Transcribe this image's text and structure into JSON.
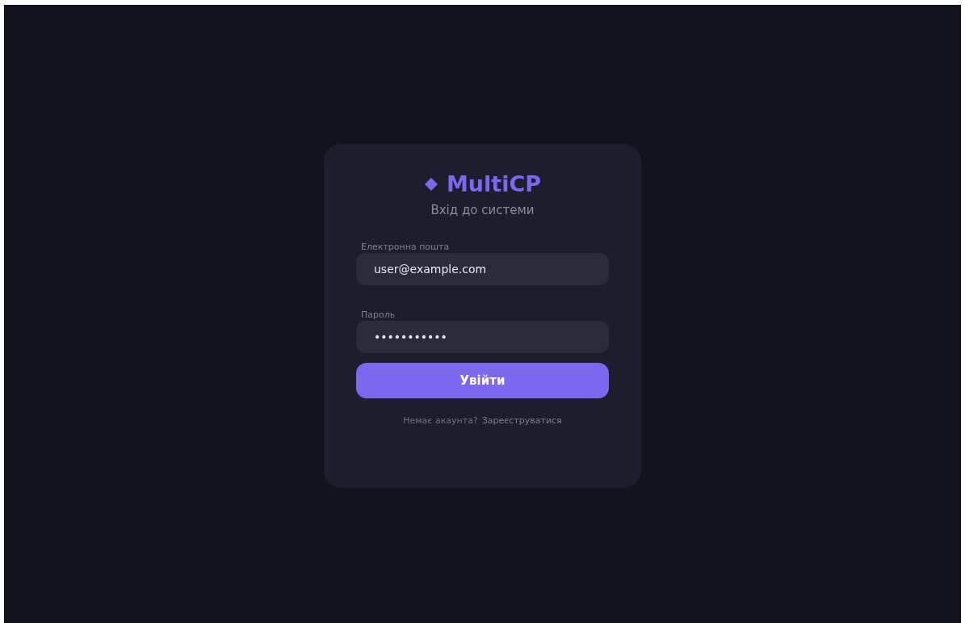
{
  "logo": {
    "text": "MultiCP"
  },
  "subtitle": "Вхід до системи",
  "fields": [
    {
      "label": "Електронна пошта",
      "value": "user@example.com"
    },
    {
      "label": "Пароль",
      "value": "•••••••••••"
    }
  ],
  "submit": "Увійти",
  "footer": {
    "text": "Немає акаунта?",
    "link": "Зареєструватися"
  }
}
